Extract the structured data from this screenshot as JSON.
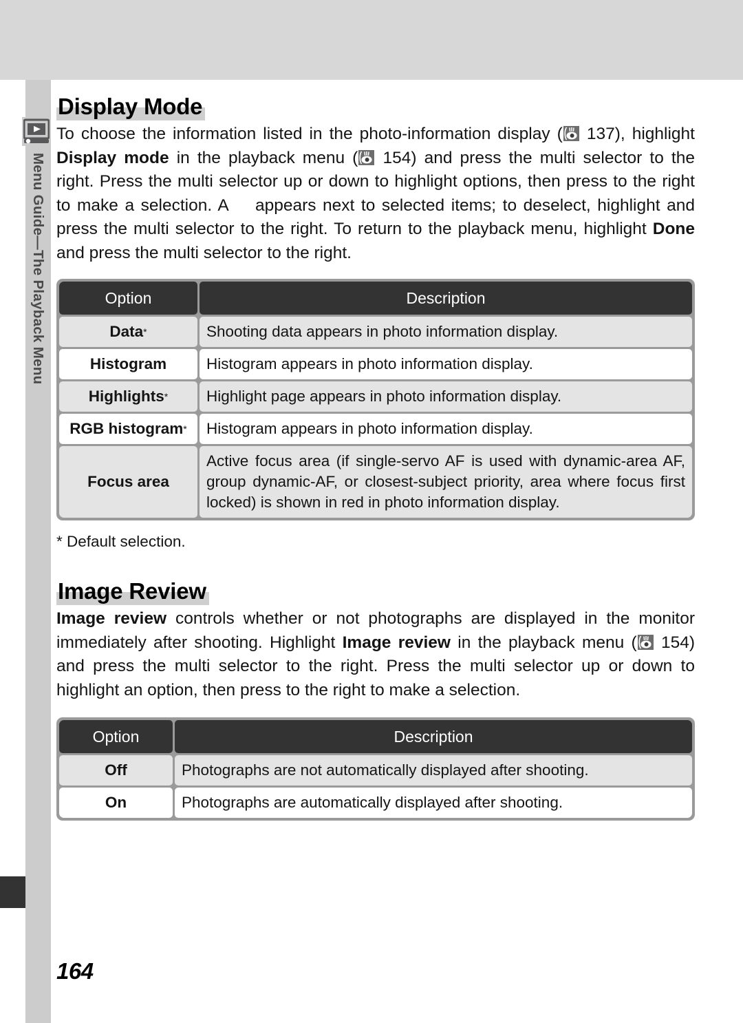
{
  "side": {
    "icon": "playback-monitor-icon",
    "label": "Menu Guide—The Playback Menu"
  },
  "page_number": "164",
  "sections": [
    {
      "heading": "Display Mode",
      "body_parts": [
        {
          "t": "text",
          "v": "To choose the information listed in the photo-information display ("
        },
        {
          "t": "eye",
          "v": "eye-reference-icon"
        },
        {
          "t": "text",
          "v": " 137), highlight "
        },
        {
          "t": "bold",
          "v": "Display mode"
        },
        {
          "t": "text",
          "v": " in the playback menu ("
        },
        {
          "t": "eye",
          "v": "eye-reference-icon"
        },
        {
          "t": "text",
          "v": " 154) and press the multi selector to the right.  Press the multi selector up or down to highlight options, then press to the right to make a selection.  A "
        },
        {
          "t": "blank",
          "v": "checkmark-glyph"
        },
        {
          "t": "text",
          "v": "appears next to selected items; to deselect, highlight and press the multi selector to the right.  To return to the playback menu, highlight "
        },
        {
          "t": "bold",
          "v": "Done"
        },
        {
          "t": "text",
          "v": " and press the multi selector to the right."
        }
      ],
      "table": {
        "headers": [
          "Option",
          "Description"
        ],
        "rows": [
          {
            "option": "Data",
            "star": true,
            "description": "Shooting data appears in photo information display."
          },
          {
            "option": "Histogram",
            "star": false,
            "description": "Histogram appears in photo information display."
          },
          {
            "option": "Highlights",
            "star": true,
            "description": "Highlight page appears in photo information display."
          },
          {
            "option": "RGB histogram",
            "star": true,
            "description": "Histogram appears in photo information display."
          },
          {
            "option": "Focus area",
            "star": false,
            "description": "Active focus area (if single-servo AF is used with dynamic-area AF, group dynamic-AF, or closest-subject priority, area where focus first locked) is shown in red in photo information display."
          }
        ]
      },
      "footnote": "* Default selection."
    },
    {
      "heading": "Image Review",
      "body_parts": [
        {
          "t": "bold",
          "v": "Image review"
        },
        {
          "t": "text",
          "v": " controls whether or not photographs are displayed in the monitor immediately after shooting.  Highlight "
        },
        {
          "t": "bold",
          "v": "Image review"
        },
        {
          "t": "text",
          "v": " in the playback menu ("
        },
        {
          "t": "eye",
          "v": "eye-reference-icon"
        },
        {
          "t": "text",
          "v": " 154) and press the multi selector to the right.  Press the multi selector up or down to highlight an option, then press to the right to make a selection."
        }
      ],
      "table": {
        "headers": [
          "Option",
          "Description"
        ],
        "rows": [
          {
            "option": "Off",
            "star": false,
            "description": "Photographs are not automatically displayed after shooting."
          },
          {
            "option": "On",
            "star": false,
            "description": "Photographs are automatically displayed after shooting."
          }
        ]
      },
      "footnote": ""
    }
  ],
  "colors": {
    "banner": "#d7d7d7",
    "side_band": "#cccccc",
    "table_header": "#333333",
    "table_border": "#9a9a9a",
    "row_shade": "#e4e4e4",
    "heading_highlight": "#cfcfcf"
  }
}
